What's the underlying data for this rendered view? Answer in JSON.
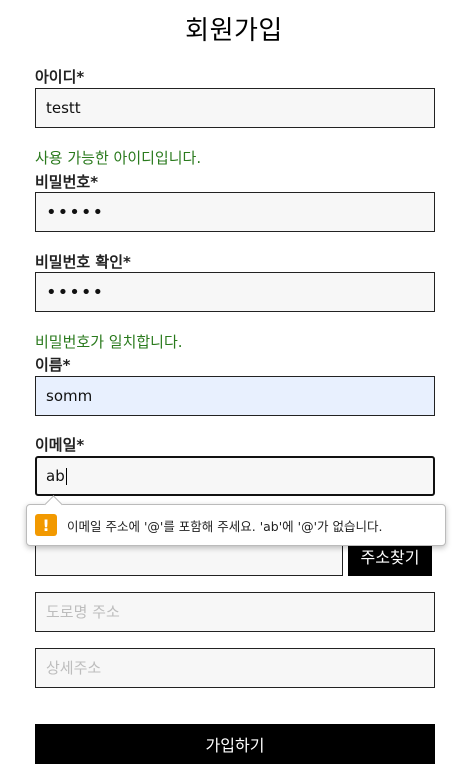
{
  "header": {
    "title": "회원가입"
  },
  "form": {
    "id": {
      "label": "아이디*",
      "value": "testt",
      "status": "사용 가능한 아이디입니다."
    },
    "password": {
      "label": "비밀번호*",
      "value": "•••••"
    },
    "password_confirm": {
      "label": "비밀번호 확인*",
      "value": "•••••",
      "status": "비밀번호가 일치합니다."
    },
    "name": {
      "label": "이름*",
      "value": "somm"
    },
    "email": {
      "label": "이메일*",
      "value": "ab"
    },
    "zip": {
      "button_label": "주소찾기"
    },
    "road_address": {
      "placeholder": "도로명 주소"
    },
    "detail_address": {
      "placeholder": "상세주소"
    },
    "submit_label": "가입하기"
  },
  "validation_tooltip": {
    "icon": "warning-icon",
    "icon_glyph": "!",
    "icon_color": "#f29900",
    "message": "이메일 주소에 '@'를 포함해 주세요. 'ab'에 '@'가 없습니다."
  },
  "colors": {
    "success_text": "#2a7a1d",
    "button_bg": "#000000",
    "autofill_bg": "#e8f0fe"
  }
}
